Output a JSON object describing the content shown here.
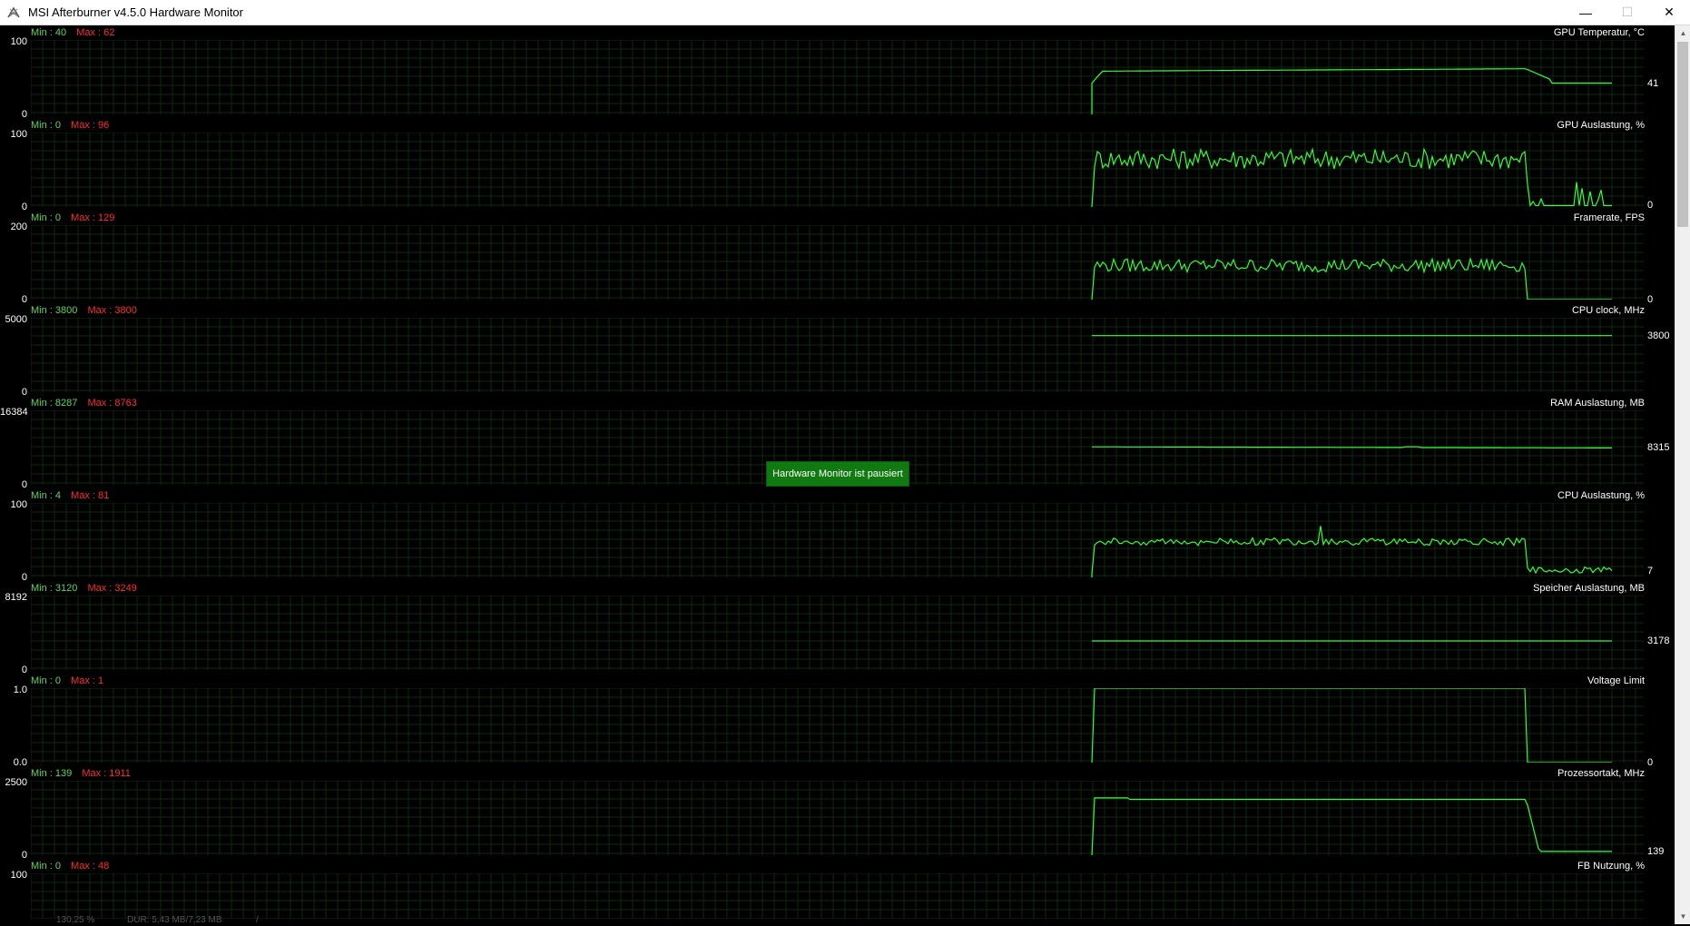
{
  "window": {
    "title": "MSI Afterburner v4.5.0 Hardware Monitor",
    "controls": {
      "minimize": "—",
      "maximize": "☐",
      "close": "✕"
    }
  },
  "paused_label": "Hardware Monitor ist pausiert",
  "bottom_strip": [
    "130,25 %",
    "DUR: 5,43 MB/7,23 MB",
    "/"
  ],
  "colors": {
    "graph": "#33ff33",
    "min": "#5ad75a",
    "max": "#ff2b2b",
    "grid": "#0e2a0e",
    "paused_bg": "#107a10"
  },
  "graphs": [
    {
      "name": "GPU Temperatur, °C",
      "min": "Min : 40",
      "max": "Max : 62",
      "ymax": "100",
      "ymin": "0",
      "current": "41",
      "kind": "temp"
    },
    {
      "name": "GPU Auslastung, %",
      "min": "Min : 0",
      "max": "Max : 96",
      "ymax": "100",
      "ymin": "0",
      "current": "0",
      "kind": "gpuload"
    },
    {
      "name": "Framerate, FPS",
      "min": "Min : 0",
      "max": "Max : 129",
      "ymax": "200",
      "ymin": "0",
      "current": "0",
      "kind": "fps"
    },
    {
      "name": "CPU clock, MHz",
      "min": "Min : 3800",
      "max": "Max : 3800",
      "ymax": "5000",
      "ymin": "0",
      "current": "3800",
      "kind": "flat"
    },
    {
      "name": "RAM Auslastung, MB",
      "min": "Min : 8287",
      "max": "Max : 8763",
      "ymax": "16384",
      "ymin": "0",
      "current": "8315",
      "kind": "ram"
    },
    {
      "name": "CPU Auslastung, %",
      "min": "Min : 4",
      "max": "Max : 81",
      "ymax": "100",
      "ymin": "0",
      "current": "7",
      "kind": "cpuload"
    },
    {
      "name": "Speicher Auslastung, MB",
      "min": "Min : 3120",
      "max": "Max : 3249",
      "ymax": "8192",
      "ymin": "0",
      "current": "3178",
      "kind": "mem"
    },
    {
      "name": "Voltage Limit",
      "min": "Min : 0",
      "max": "Max : 1",
      "ymax": "1.0",
      "ymin": "0.0",
      "current": "0",
      "kind": "volt"
    },
    {
      "name": "Prozessortakt, MHz",
      "min": "Min : 139",
      "max": "Max : 1911",
      "ymax": "2500",
      "ymin": "0",
      "current": "139",
      "kind": "clock"
    },
    {
      "name": "FB Nutzung, %",
      "min": "Min : 0",
      "max": "Max : 48",
      "ymax": "100",
      "ymin": "",
      "current": "",
      "kind": "fb"
    }
  ]
}
